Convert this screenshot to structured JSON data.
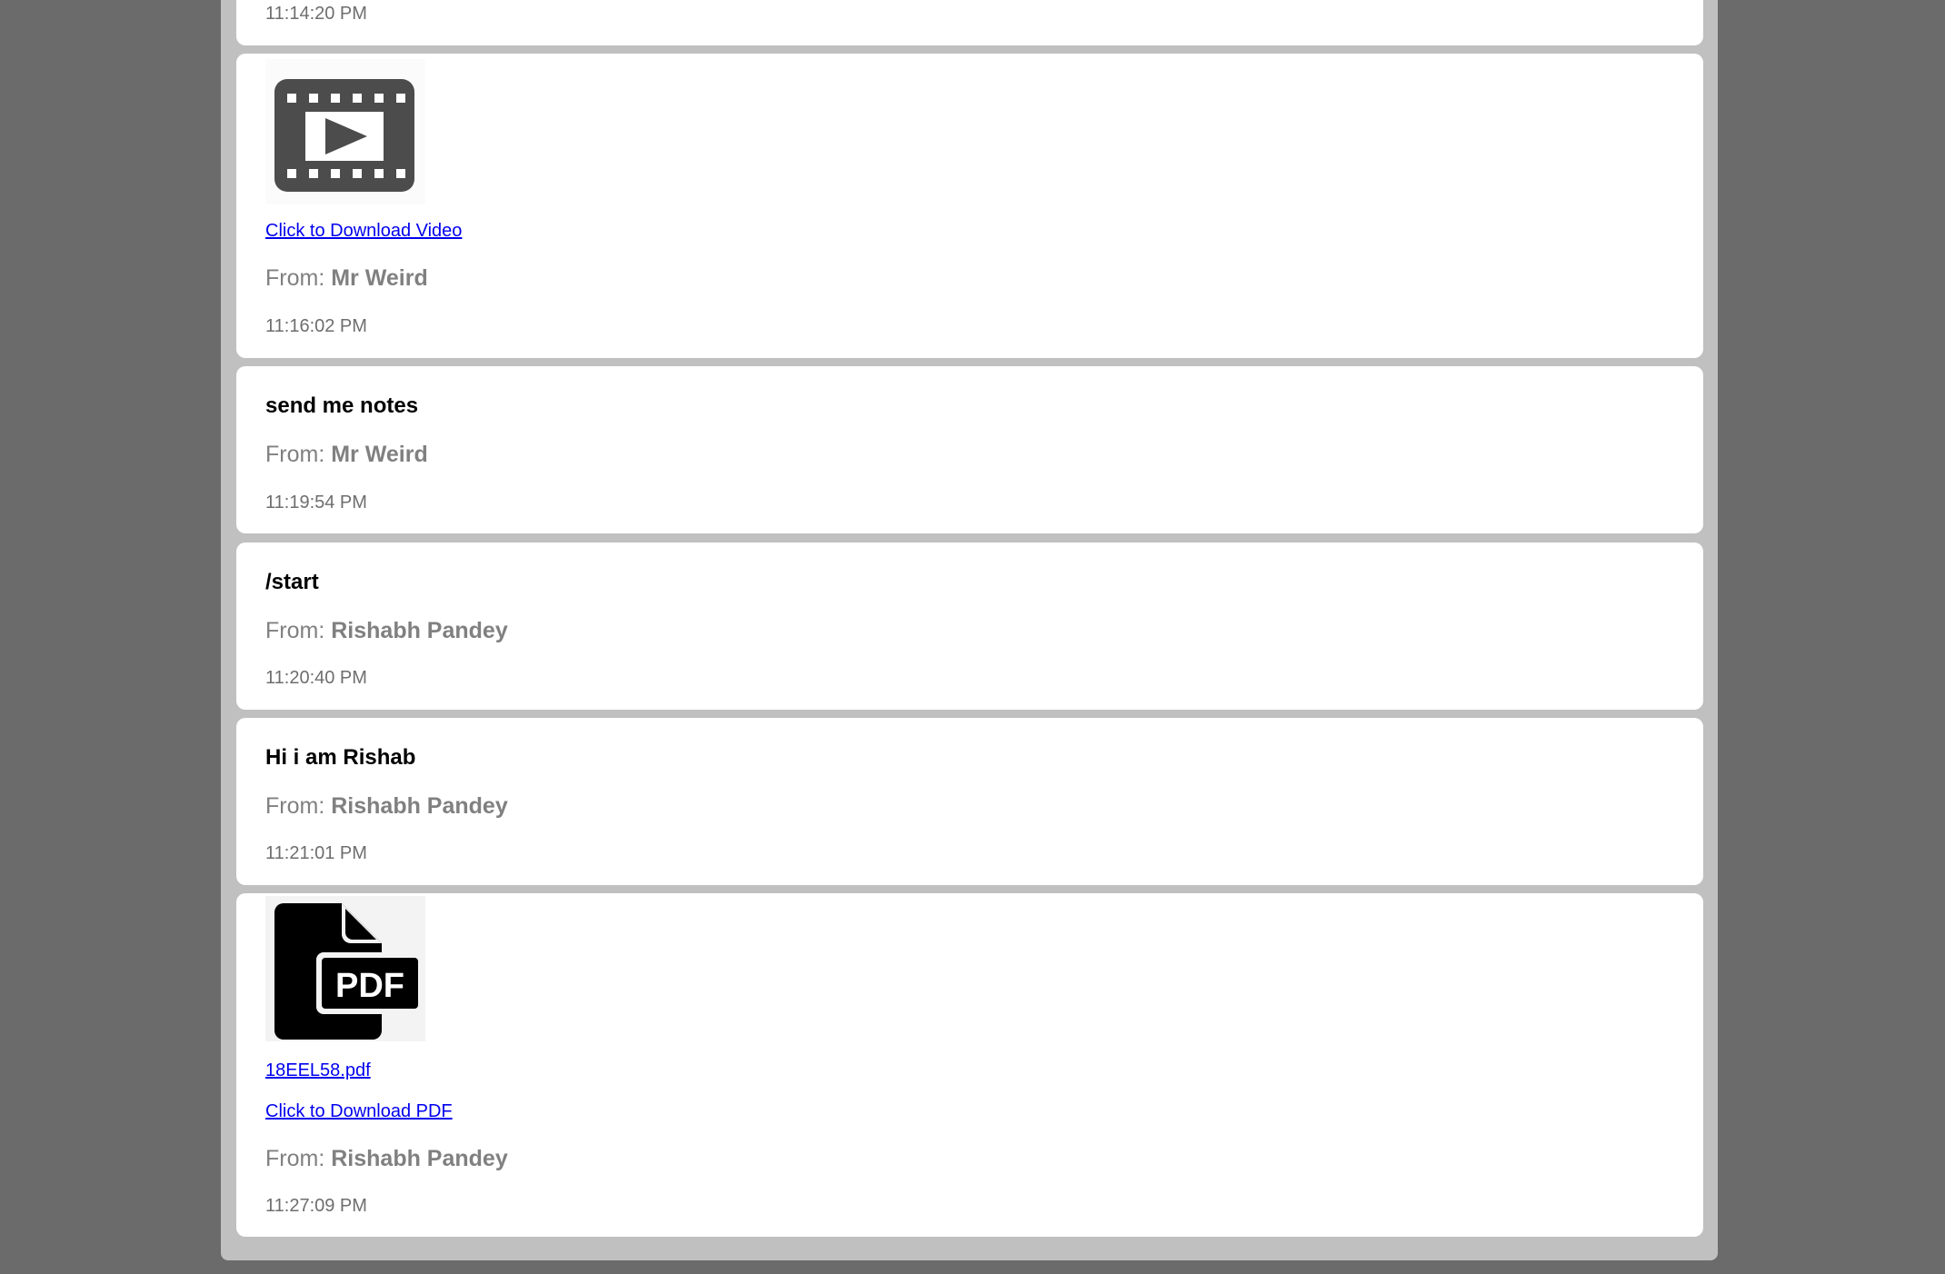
{
  "messages": [
    {
      "time": "11:14:20 PM"
    },
    {
      "type": "video",
      "icon": "video-file-icon",
      "download_label": "Click to Download Video",
      "from_label": "From:",
      "sender": "Mr Weird",
      "time": "11:16:02 PM"
    },
    {
      "type": "text",
      "text": "send me notes",
      "from_label": "From:",
      "sender": "Mr Weird",
      "time": "11:19:54 PM"
    },
    {
      "type": "text",
      "text": "/start",
      "from_label": "From:",
      "sender": "Rishabh Pandey",
      "time": "11:20:40 PM"
    },
    {
      "type": "text",
      "text": "Hi i am Rishab",
      "from_label": "From:",
      "sender": "Rishabh Pandey",
      "time": "11:21:01 PM"
    },
    {
      "type": "pdf",
      "icon": "pdf-file-icon",
      "icon_text": "PDF",
      "file_name": "18EEL58.pdf",
      "download_label": "Click to Download PDF",
      "from_label": "From:",
      "sender": "Rishabh Pandey",
      "time": "11:27:09 PM"
    }
  ],
  "colors": {
    "page_background": "#6b6b6b",
    "panel_background": "#c0c0c0",
    "card_background": "#ffffff",
    "link": "#0000ee",
    "sender_text": "#808080"
  }
}
